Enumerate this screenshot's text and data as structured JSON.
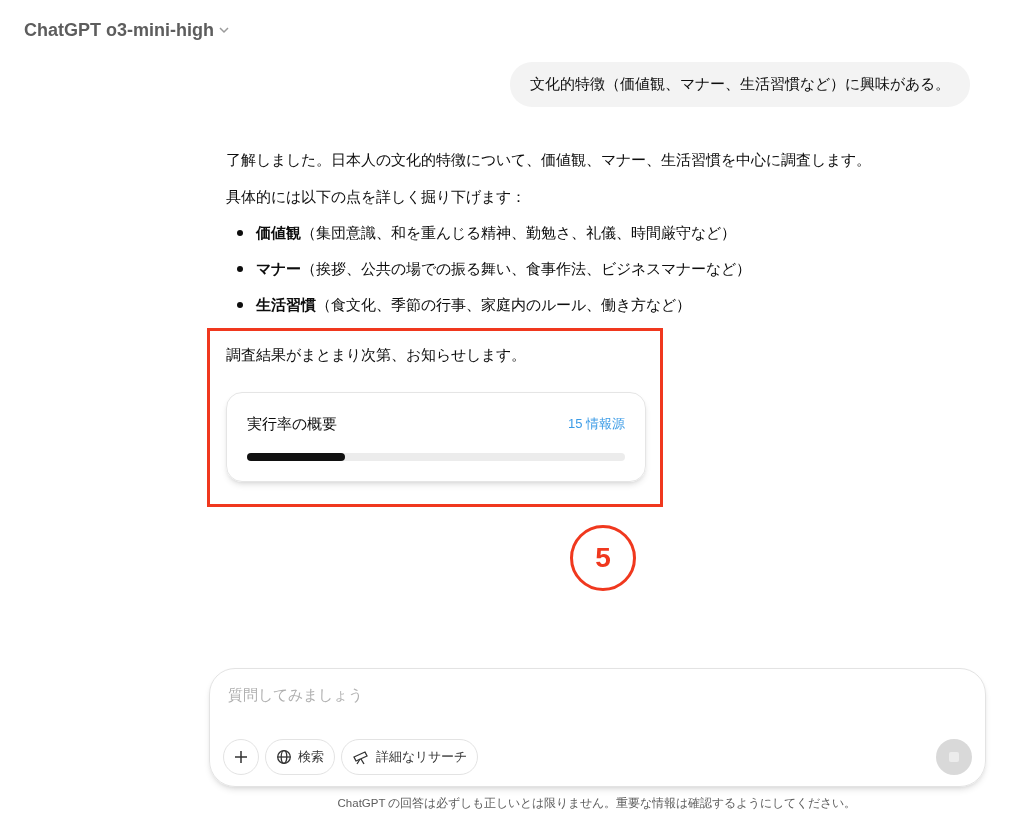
{
  "header": {
    "model": "ChatGPT o3-mini-high"
  },
  "user_message": "文化的特徴（価値観、マナー、生活習慣など）に興味がある。",
  "assistant": {
    "intro": "了解しました。日本人の文化的特徴について、価値観、マナー、生活習慣を中心に調査します。",
    "lead": "具体的には以下の点を詳しく掘り下げます：",
    "bullets": [
      {
        "term": "価値観",
        "detail": "（集団意識、和を重んじる精神、勤勉さ、礼儀、時間厳守など）"
      },
      {
        "term": "マナー",
        "detail": "（挨拶、公共の場での振る舞い、食事作法、ビジネスマナーなど）"
      },
      {
        "term": "生活習慣",
        "detail": "（食文化、季節の行事、家庭内のルール、働き方など）"
      }
    ],
    "closing": "調査結果がまとまり次第、お知らせします。",
    "research_card": {
      "title": "実行率の概要",
      "sources": "15 情報源",
      "level": 0.26
    }
  },
  "annotation": {
    "number": "5"
  },
  "composer": {
    "placeholder": "質問してみましょう",
    "buttons": [
      {
        "kind": "plus"
      },
      {
        "kind": "search",
        "label": "検索"
      },
      {
        "kind": "research",
        "label": "詳細なリサーチ"
      }
    ]
  },
  "disclaimer": "ChatGPT の回答は必ずしも正しいとは限りません。重要な情報は確認するようにしてください。"
}
